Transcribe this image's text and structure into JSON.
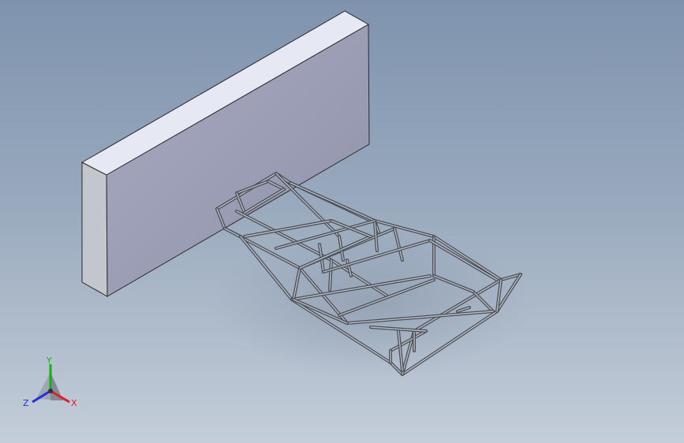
{
  "viewport": {
    "background_top": "#7f93ae",
    "background_bottom": "#c4cdd9"
  },
  "scene": {
    "objects": [
      {
        "name": "wall-block",
        "type": "rectangular-prism",
        "face_top": "#e6e9f3",
        "face_front": "#9a9db4",
        "face_side": "#c3c6cc"
      },
      {
        "name": "chassis-frame",
        "type": "tube-space-frame",
        "tube_color": "#4a4f57"
      }
    ]
  },
  "triad": {
    "x_label": "X",
    "y_label": "Y",
    "z_label": "Z",
    "x_color": "#e02020",
    "y_color": "#16b016",
    "z_color": "#2030e0",
    "icon": "coordinate-triad-icon"
  }
}
